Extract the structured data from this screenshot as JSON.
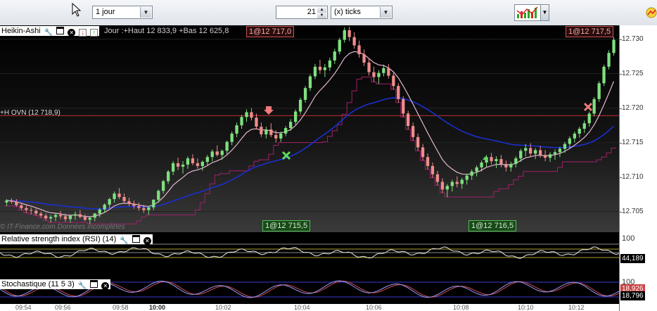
{
  "toolbar": {
    "period_value": "1 jour",
    "ticks_count": "21",
    "ticks_unit": "(x) ticks"
  },
  "main_panel": {
    "title": "Heikin-Ashi",
    "day_info": "Jour :+Haut 12 833,9 +Bas 12 625,8",
    "tag_left": "1@12 717,0",
    "tag_right": "1@12 717,5",
    "ovn_label": "+H OVN (12 718,9)",
    "watermark": "© IT-Finance.com Données incomplètes",
    "tag_bottom_1": "1@12 715,5",
    "tag_bottom_2": "1@12 716,5",
    "y_ticks": [
      "12.730",
      "12.725",
      "12.720",
      "12.715",
      "12.710",
      "12.705"
    ]
  },
  "rsi_panel": {
    "title": "Relative strength index (RSI) (14)",
    "axis_label": "100",
    "value": "44,189"
  },
  "stoch_panel": {
    "title": "Stochastique (11 5 3)",
    "axis_label": "100",
    "value_hidden": "18,926",
    "value": "18,796"
  },
  "x_axis": [
    "09:54",
    "09:56",
    "09:58",
    "10:00",
    "10:02",
    "10:04",
    "10:06",
    "10:08",
    "10:10",
    "10:12"
  ],
  "colors": {
    "up_candle": "#7fe07f",
    "down_candle": "#f08c8c",
    "ma_blue": "#1b2fd0",
    "ma_pink": "#e3b6cf",
    "ma_purple": "#a0206a",
    "ovn_line": "#c03030"
  },
  "chart_data": {
    "type": "candlestick",
    "ylim": [
      12702,
      12732
    ],
    "candles": [
      [
        12706.3,
        12706.8,
        12705.8,
        12706.6
      ],
      [
        12706.6,
        12706.9,
        12706.1,
        12706.4
      ],
      [
        12706.4,
        12706.8,
        12705.7,
        12705.9
      ],
      [
        12705.9,
        12706.3,
        12705.2,
        12705.5
      ],
      [
        12705.5,
        12705.9,
        12704.8,
        12705.2
      ],
      [
        12705.2,
        12705.6,
        12704.6,
        12705.1
      ],
      [
        12705.1,
        12705.4,
        12704.4,
        12704.7
      ],
      [
        12704.7,
        12705.0,
        12704.1,
        12704.4
      ],
      [
        12704.4,
        12704.7,
        12703.7,
        12704.0
      ],
      [
        12704.0,
        12704.5,
        12703.4,
        12704.2
      ],
      [
        12704.2,
        12704.8,
        12703.6,
        12704.5
      ],
      [
        12704.5,
        12705.1,
        12703.9,
        12704.3
      ],
      [
        12704.3,
        12704.7,
        12703.5,
        12703.9
      ],
      [
        12703.9,
        12704.5,
        12703.4,
        12704.4
      ],
      [
        12704.4,
        12705.0,
        12703.8,
        12704.6
      ],
      [
        12704.6,
        12705.2,
        12704.0,
        12704.2
      ],
      [
        12704.2,
        12704.6,
        12703.6,
        12703.8
      ],
      [
        12703.8,
        12704.3,
        12703.2,
        12704.1
      ],
      [
        12704.1,
        12704.8,
        12703.6,
        12704.7
      ],
      [
        12704.7,
        12705.5,
        12704.2,
        12705.3
      ],
      [
        12705.3,
        12706.2,
        12704.8,
        12706.0
      ],
      [
        12706.0,
        12707.0,
        12705.5,
        12706.8
      ],
      [
        12706.8,
        12707.9,
        12706.3,
        12707.6
      ],
      [
        12707.6,
        12708.4,
        12706.8,
        12707.1
      ],
      [
        12707.1,
        12707.6,
        12706.2,
        12706.5
      ],
      [
        12706.5,
        12707.0,
        12705.8,
        12706.1
      ],
      [
        12706.1,
        12706.6,
        12705.4,
        12705.8
      ],
      [
        12705.8,
        12706.3,
        12705.1,
        12705.5
      ],
      [
        12705.5,
        12706.0,
        12704.8,
        12705.2
      ],
      [
        12705.2,
        12705.8,
        12704.5,
        12705.6
      ],
      [
        12705.6,
        12706.8,
        12705.2,
        12706.7
      ],
      [
        12706.7,
        12708.2,
        12706.3,
        12708.0
      ],
      [
        12708.0,
        12709.6,
        12707.6,
        12709.4
      ],
      [
        12709.4,
        12711.0,
        12709.0,
        12710.8
      ],
      [
        12710.8,
        12712.3,
        12710.3,
        12712.0
      ],
      [
        12712.0,
        12712.8,
        12711.0,
        12711.5
      ],
      [
        12711.5,
        12712.3,
        12710.5,
        12711.8
      ],
      [
        12711.8,
        12713.0,
        12711.2,
        12712.7
      ],
      [
        12712.7,
        12713.3,
        12711.7,
        12712.0
      ],
      [
        12712.0,
        12712.7,
        12711.2,
        12711.6
      ],
      [
        12711.6,
        12712.4,
        12710.9,
        12712.2
      ],
      [
        12712.2,
        12713.2,
        12711.6,
        12712.9
      ],
      [
        12712.9,
        12714.0,
        12712.3,
        12713.7
      ],
      [
        12713.7,
        12714.6,
        12713.0,
        12713.2
      ],
      [
        12713.2,
        12714.0,
        12712.5,
        12713.8
      ],
      [
        12713.8,
        12715.3,
        12713.3,
        12715.1
      ],
      [
        12715.1,
        12716.6,
        12714.6,
        12716.3
      ],
      [
        12716.3,
        12717.9,
        12715.8,
        12717.5
      ],
      [
        12717.5,
        12719.0,
        12717.0,
        12718.7
      ],
      [
        12718.7,
        12719.8,
        12718.0,
        12719.4
      ],
      [
        12719.4,
        12720.0,
        12718.2,
        12718.6
      ],
      [
        12718.6,
        12719.2,
        12716.9,
        12717.3
      ],
      [
        12717.3,
        12717.9,
        12715.8,
        12716.2
      ],
      [
        12716.2,
        12717.3,
        12715.6,
        12716.9
      ],
      [
        12716.9,
        12717.8,
        12715.8,
        12716.1
      ],
      [
        12716.1,
        12716.8,
        12715.0,
        12715.6
      ],
      [
        12715.6,
        12716.6,
        12715.1,
        12716.3
      ],
      [
        12716.3,
        12717.4,
        12715.9,
        12717.1
      ],
      [
        12717.1,
        12718.4,
        12716.7,
        12718.0
      ],
      [
        12718.0,
        12719.8,
        12717.6,
        12719.5
      ],
      [
        12719.5,
        12721.5,
        12719.1,
        12721.2
      ],
      [
        12721.2,
        12723.2,
        12720.8,
        12722.9
      ],
      [
        12722.9,
        12724.9,
        12722.5,
        12724.6
      ],
      [
        12724.6,
        12726.4,
        12724.2,
        12726.0
      ],
      [
        12726.0,
        12727.0,
        12725.0,
        12725.5
      ],
      [
        12725.5,
        12726.4,
        12724.5,
        12725.9
      ],
      [
        12725.9,
        12727.3,
        12725.4,
        12726.9
      ],
      [
        12726.9,
        12728.6,
        12726.4,
        12728.2
      ],
      [
        12728.2,
        12730.2,
        12727.8,
        12729.9
      ],
      [
        12729.9,
        12731.7,
        12729.5,
        12731.3
      ],
      [
        12731.3,
        12731.8,
        12729.7,
        12730.3
      ],
      [
        12730.3,
        12731.0,
        12728.6,
        12729.1
      ],
      [
        12729.1,
        12729.8,
        12727.3,
        12727.8
      ],
      [
        12727.8,
        12728.5,
        12726.1,
        12726.6
      ],
      [
        12726.6,
        12727.2,
        12724.7,
        12725.2
      ],
      [
        12725.2,
        12726.0,
        12723.8,
        12724.5
      ],
      [
        12724.5,
        12725.5,
        12723.5,
        12725.1
      ],
      [
        12725.1,
        12726.3,
        12724.6,
        12725.8
      ],
      [
        12725.8,
        12726.4,
        12724.3,
        12724.7
      ],
      [
        12724.7,
        12725.1,
        12722.7,
        12723.2
      ],
      [
        12723.2,
        12723.6,
        12720.8,
        12721.3
      ],
      [
        12721.3,
        12721.7,
        12718.7,
        12719.2
      ],
      [
        12719.2,
        12719.6,
        12716.9,
        12717.4
      ],
      [
        12717.4,
        12717.9,
        12715.3,
        12715.8
      ],
      [
        12715.8,
        12716.3,
        12713.8,
        12714.3
      ],
      [
        12714.3,
        12714.8,
        12712.4,
        12712.9
      ],
      [
        12712.9,
        12713.4,
        12711.1,
        12711.6
      ],
      [
        12711.6,
        12712.1,
        12709.9,
        12710.4
      ],
      [
        12710.4,
        12710.9,
        12708.8,
        12709.3
      ],
      [
        12709.3,
        12709.8,
        12707.7,
        12708.2
      ],
      [
        12708.2,
        12709.0,
        12707.1,
        12708.7
      ],
      [
        12708.7,
        12709.6,
        12707.9,
        12709.3
      ],
      [
        12709.3,
        12710.1,
        12708.5,
        12709.0
      ],
      [
        12709.0,
        12709.9,
        12708.3,
        12709.6
      ],
      [
        12709.6,
        12710.5,
        12708.9,
        12710.2
      ],
      [
        12710.2,
        12711.1,
        12709.6,
        12710.8
      ],
      [
        12710.8,
        12711.7,
        12710.1,
        12711.4
      ],
      [
        12711.4,
        12712.4,
        12710.8,
        12712.1
      ],
      [
        12712.1,
        12713.2,
        12711.5,
        12712.9
      ],
      [
        12712.9,
        12713.5,
        12711.8,
        12712.3
      ],
      [
        12712.3,
        12713.0,
        12711.3,
        12712.6
      ],
      [
        12712.6,
        12713.2,
        12711.4,
        12711.9
      ],
      [
        12711.9,
        12712.4,
        12710.8,
        12711.4
      ],
      [
        12711.4,
        12712.2,
        12710.8,
        12711.9
      ],
      [
        12711.9,
        12713.0,
        12711.4,
        12712.7
      ],
      [
        12712.7,
        12714.1,
        12712.2,
        12713.8
      ],
      [
        12713.8,
        12714.8,
        12713.0,
        12714.2
      ],
      [
        12714.2,
        12714.9,
        12712.9,
        12713.4
      ],
      [
        12713.4,
        12714.2,
        12712.6,
        12713.9
      ],
      [
        12713.9,
        12714.5,
        12712.8,
        12713.2
      ],
      [
        12713.2,
        12713.9,
        12712.3,
        12712.8
      ],
      [
        12712.8,
        12713.6,
        12712.2,
        12713.3
      ],
      [
        12713.3,
        12714.0,
        12712.5,
        12713.6
      ],
      [
        12713.6,
        12714.4,
        12712.9,
        12714.1
      ],
      [
        12714.1,
        12715.1,
        12713.5,
        12714.8
      ],
      [
        12714.8,
        12715.9,
        12714.2,
        12715.6
      ],
      [
        12715.6,
        12716.6,
        12715.0,
        12716.3
      ],
      [
        12716.3,
        12717.3,
        12715.7,
        12717.0
      ],
      [
        12717.0,
        12718.2,
        12716.4,
        12717.8
      ],
      [
        12717.8,
        12719.5,
        12717.3,
        12719.2
      ],
      [
        12719.2,
        12721.6,
        12718.8,
        12721.3
      ],
      [
        12721.3,
        12723.9,
        12720.9,
        12723.6
      ],
      [
        12723.6,
        12726.3,
        12723.2,
        12726.0
      ],
      [
        12726.0,
        12728.4,
        12725.6,
        12728.0
      ],
      [
        12728.0,
        12730.3,
        12727.6,
        12729.9
      ]
    ],
    "ovn_level": 12718.9
  }
}
